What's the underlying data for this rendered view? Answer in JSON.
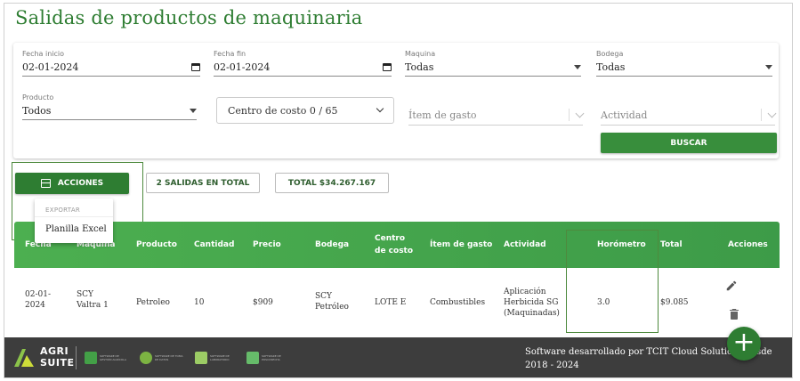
{
  "page": {
    "title": "Salidas de productos de maquinaria"
  },
  "filters": {
    "fecha_inicio": {
      "label": "Fecha inicio",
      "value": "02-01-2024"
    },
    "fecha_fin": {
      "label": "Fecha fin",
      "value": "02-01-2024"
    },
    "maquina": {
      "label": "Maquina",
      "value": "Todas"
    },
    "bodega": {
      "label": "Bodega",
      "value": "Todas"
    },
    "producto": {
      "label": "Producto",
      "value": "Todos"
    },
    "centro_costo": {
      "value": "Centro de costo 0 / 65"
    },
    "item_gasto": {
      "placeholder": "Ítem de gasto"
    },
    "actividad": {
      "placeholder": "Actividad"
    },
    "buscar_label": "BUSCAR"
  },
  "toolbar": {
    "acciones_label": "ACCIONES",
    "salidas_total": "2 SALIDAS EN TOTAL",
    "total": "TOTAL $34.267.167"
  },
  "dropdown": {
    "header": "EXPORTAR",
    "option": "Planilla Excel"
  },
  "table": {
    "headers": {
      "fecha": "Fecha",
      "maquina": "Maquina",
      "producto": "Producto",
      "cantidad": "Cantidad",
      "precio": "Precio",
      "bodega": "Bodega",
      "centro1": "Centro",
      "centro2": "de costo",
      "item": "Ítem de gasto",
      "actividad": "Actividad",
      "horometro": "Horómetro",
      "total": "Total",
      "acciones": "Acciones"
    },
    "rows": [
      {
        "fecha1": "02-01-",
        "fecha2": "2024",
        "maquina1": "SCY",
        "maquina2": "Valtra 1",
        "producto": "Petroleo",
        "cantidad": "10",
        "precio": "$909",
        "bodega1": "SCY",
        "bodega2": "Petróleo",
        "centro": "LOTE E",
        "item": "Combustibles",
        "actividad1": "Aplicación",
        "actividad2": "Herbicida SG",
        "actividad3": "(Maquinadas)",
        "horometro": "3.0",
        "total": "$9.085"
      }
    ]
  },
  "footer": {
    "logo1": "AGRI",
    "logo2": "SUITE",
    "text": "Software desarrollado por TCIT Cloud Solutions desde 2018 - 2024",
    "sublogos": [
      "SOFTWARE DE GESTIÓN AGRÍCOLA",
      "SOFTWARE DE TOMA DE DATOS",
      "SOFTWARE DE LABORATORIO",
      "SOFTWARE DE POSCOSECHA"
    ]
  },
  "colors": {
    "primary": "#2e7d32",
    "accent": "#4caf50",
    "footer": "#3d3d3d"
  },
  "icons": [
    "calendar-icon",
    "caret-down-icon",
    "chevron-down-icon",
    "actions-icon",
    "pencil-icon",
    "trash-icon",
    "plus-icon"
  ]
}
